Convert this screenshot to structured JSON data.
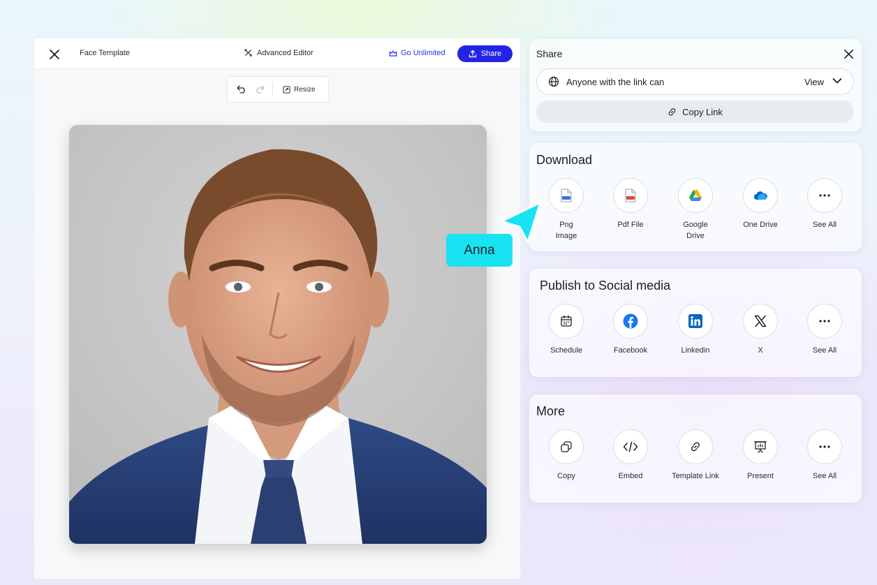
{
  "editor": {
    "title": "Face Template",
    "advanced_editor": "Advanced Editor",
    "go_unlimited": "Go Unlimited",
    "share": "Share",
    "resize": "Resize"
  },
  "share_panel": {
    "title": "Share",
    "link_access": "Anyone with the link can",
    "permission": "View",
    "copy_link": "Copy Link"
  },
  "download": {
    "title": "Download",
    "items": [
      {
        "label": "Png Image",
        "icon": "png-file-icon"
      },
      {
        "label": "Pdf File",
        "icon": "pdf-file-icon"
      },
      {
        "label": "Google Drive",
        "icon": "google-drive-icon"
      },
      {
        "label": "One Drive",
        "icon": "onedrive-icon"
      },
      {
        "label": "See All",
        "icon": "more-dots-icon"
      }
    ]
  },
  "social": {
    "title": "Publish to Social media",
    "items": [
      {
        "label": "Schedule",
        "icon": "calendar-icon"
      },
      {
        "label": "Facebook",
        "icon": "facebook-icon"
      },
      {
        "label": "Linkedin",
        "icon": "linkedin-icon"
      },
      {
        "label": "X",
        "icon": "x-icon"
      },
      {
        "label": "See All",
        "icon": "more-dots-icon"
      }
    ]
  },
  "more": {
    "title": "More",
    "items": [
      {
        "label": "Copy",
        "icon": "copy-icon"
      },
      {
        "label": "Embed",
        "icon": "code-icon"
      },
      {
        "label": "Template Link",
        "icon": "link-icon"
      },
      {
        "label": "Present",
        "icon": "presentation-icon"
      },
      {
        "label": "See All",
        "icon": "more-dots-icon"
      }
    ]
  },
  "collaborator": {
    "name": "Anna",
    "color": "#17e3f2"
  },
  "colors": {
    "accent": "#2424e6",
    "go_unlimited": "#2a34e0"
  }
}
